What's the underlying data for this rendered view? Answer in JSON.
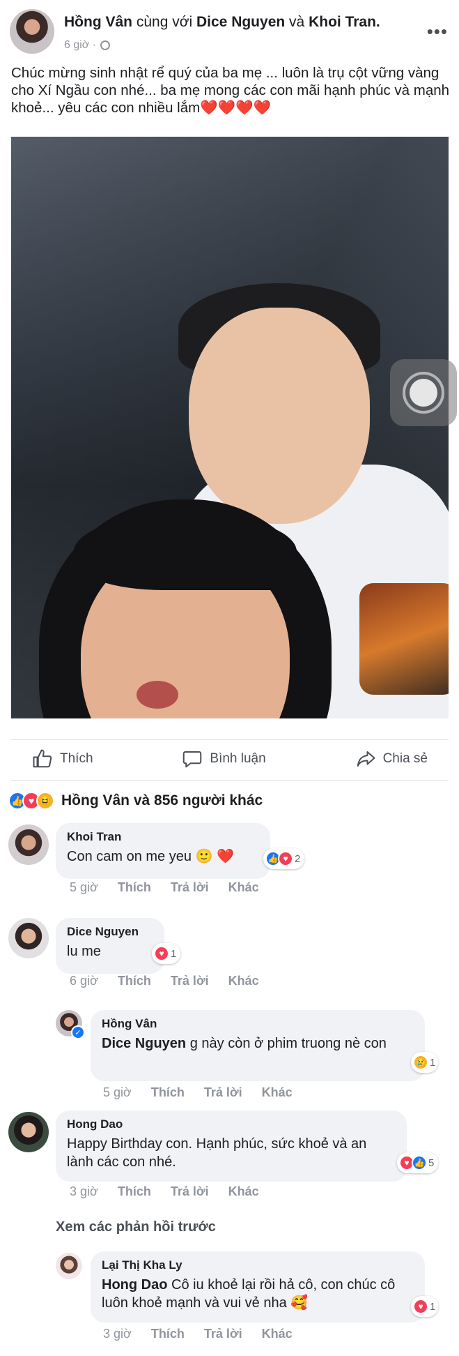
{
  "post": {
    "author": "Hồng Vân",
    "with_text": "cùng với",
    "tag1": "Dice Nguyen",
    "and_text": "và",
    "tag2": "Khoi Tran.",
    "time": "6 giờ ·",
    "more": "•••",
    "text": "Chúc mừng sinh nhật rể quý của ba mẹ ... luôn là trụ cột vững vàng cho Xí Ngầu con nhé... ba mẹ mong các con mãi hạnh phúc và mạnh khoẻ... yêu các con nhiều lắm",
    "text_hearts": "❤️❤️❤️❤️"
  },
  "actions": {
    "like": "Thích",
    "comment": "Bình luận",
    "share": "Chia sẻ"
  },
  "reactions": {
    "summary": "Hồng Vân và 856 người khác"
  },
  "comments": [
    {
      "name": "Khoi Tran",
      "text": "Con cam on me yeu 🙂 ❤️",
      "time": "5 giờ",
      "like": "Thích",
      "reply": "Trả lời",
      "more": "Khác",
      "reaction_count": "2"
    },
    {
      "name": "Dice Nguyen",
      "text": "lu me",
      "time": "6 giờ",
      "like": "Thích",
      "reply": "Trả lời",
      "more": "Khác",
      "reaction_count": "1"
    },
    {
      "name": "Hồng Vân",
      "mention": "Dice Nguyen",
      "text": " g này còn ở phim truong nè con",
      "time": "5 giờ",
      "like": "Thích",
      "reply": "Trả lời",
      "more": "Khác",
      "reaction_count": "1"
    },
    {
      "name": "Hong Dao",
      "text": "Happy Birthday con. Hạnh phúc, sức khoẻ và an lành các con nhé.",
      "time": "3 giờ",
      "like": "Thích",
      "reply": "Trả lời",
      "more": "Khác",
      "reaction_count": "5"
    },
    {
      "name": "Lại Thị Kha Ly",
      "mention": "Hong Dao",
      "text": " Cô iu khoẻ lại rồi hả cô, con chúc cô luôn khoẻ mạnh và vui vẻ nha 🥰",
      "time": "3 giờ",
      "like": "Thích",
      "reply": "Trả lời",
      "more": "Khác",
      "reaction_count": "1"
    }
  ],
  "view_previous": "Xem các phản hồi trước",
  "colors": {
    "like_blue": "#1877f2",
    "love_red": "#f33e58",
    "bubble_gray": "#f0f2f5",
    "meta_gray": "#90949c"
  }
}
